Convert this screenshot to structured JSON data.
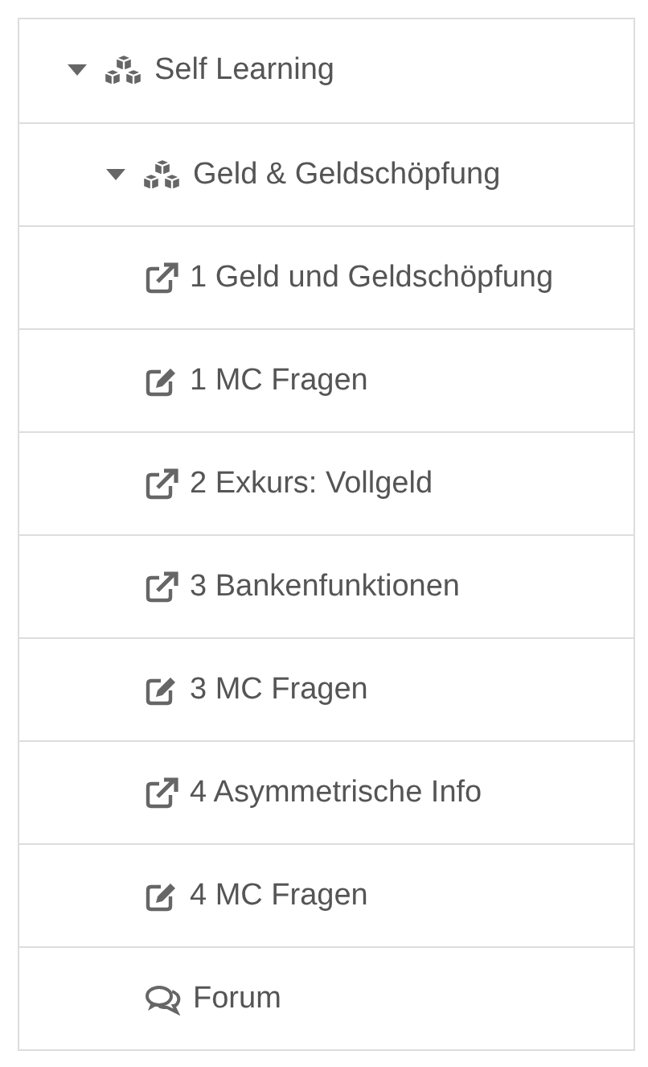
{
  "tree": [
    {
      "label": "Self Learning",
      "kind": "folder",
      "expanded": true,
      "children": [
        {
          "label": "Geld & Geldschöpfung",
          "kind": "folder",
          "expanded": true,
          "children": [
            {
              "label": "1 Geld und Geldschöpfung",
              "kind": "link"
            },
            {
              "label": "1 MC Fragen",
              "kind": "quiz"
            },
            {
              "label": "2 Exkurs: Vollgeld",
              "kind": "link"
            },
            {
              "label": "3 Bankenfunktionen",
              "kind": "link"
            },
            {
              "label": "3 MC Fragen",
              "kind": "quiz"
            },
            {
              "label": "4 Asymmetrische Info",
              "kind": "link"
            },
            {
              "label": "4 MC Fragen",
              "kind": "quiz"
            },
            {
              "label": "Forum",
              "kind": "forum"
            }
          ]
        }
      ]
    }
  ]
}
